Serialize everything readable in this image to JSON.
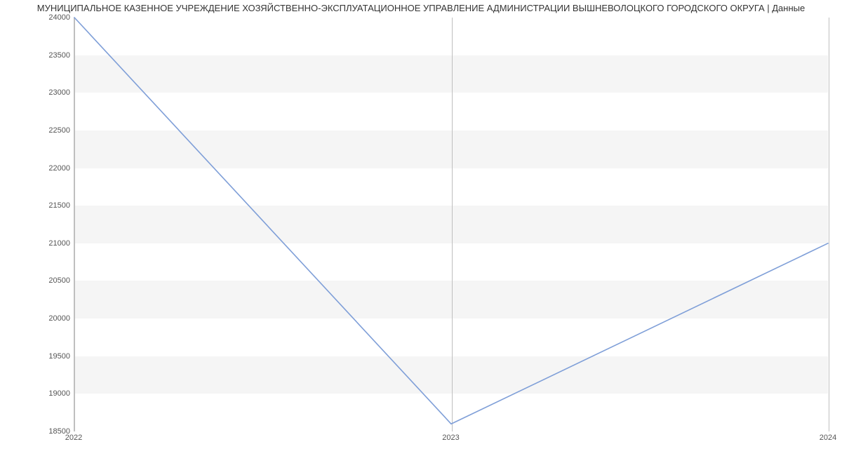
{
  "chart_data": {
    "type": "line",
    "title": "МУНИЦИПАЛЬНОЕ КАЗЕННОЕ УЧРЕЖДЕНИЕ ХОЗЯЙСТВЕННО-ЭКСПЛУАТАЦИОННОЕ УПРАВЛЕНИЕ АДМИНИСТРАЦИИ ВЫШНЕВОЛОЦКОГО ГОРОДСКОГО ОКРУГА | Данные",
    "x": [
      2022,
      2023,
      2024
    ],
    "values": [
      24000,
      18600,
      21000
    ],
    "xlabel": "",
    "ylabel": "",
    "xlim": [
      2022,
      2024
    ],
    "ylim": [
      18500,
      24000
    ],
    "x_ticks": [
      2022,
      2023,
      2024
    ],
    "y_ticks": [
      18500,
      19000,
      19500,
      20000,
      20500,
      21000,
      21500,
      22000,
      22500,
      23000,
      23500,
      24000
    ],
    "line_color": "#7f9fd8",
    "grid_band_color": "#f5f5f5"
  }
}
